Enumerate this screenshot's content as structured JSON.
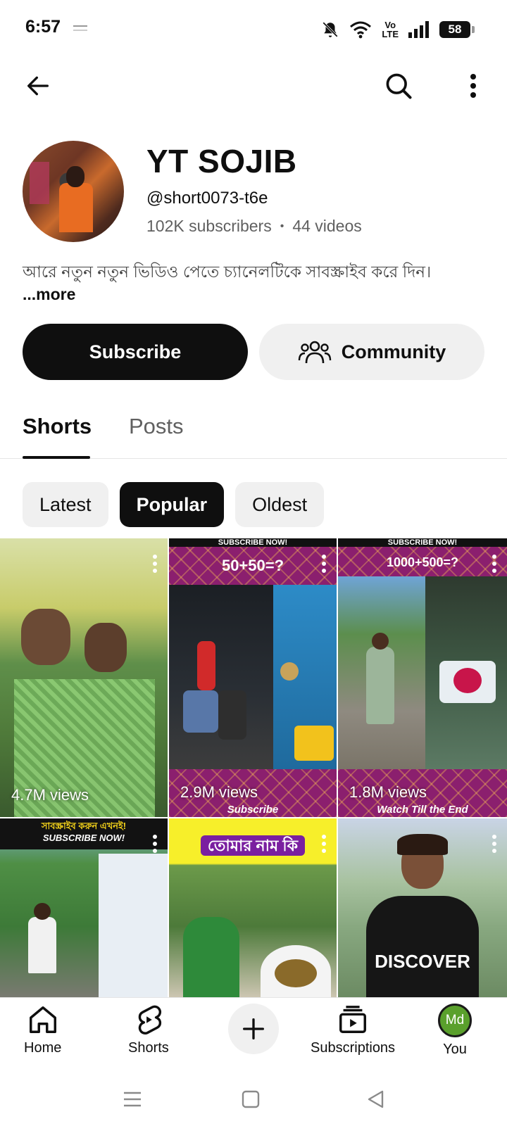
{
  "status_bar": {
    "time": "6:57",
    "network_label": "Vo\nLTE",
    "battery": "58"
  },
  "top_bar": {
    "icons": [
      "back-arrow-icon",
      "search-icon",
      "more-vert-icon"
    ]
  },
  "channel": {
    "name": "YT SOJIB",
    "handle": "@short0073-t6e",
    "subscribers": "102K subscribers",
    "separator": "•",
    "videos": "44 videos",
    "description": "আরে নতুন নতুন ভিডিও পেতে চ্যানেলটিকে সাবস্ক্রাইব করে দিন।",
    "more_label": "...more"
  },
  "actions": {
    "subscribe_label": "Subscribe",
    "community_label": "Community"
  },
  "tabs": [
    {
      "label": "Shorts",
      "active": true
    },
    {
      "label": "Posts",
      "active": false
    }
  ],
  "chips": [
    {
      "label": "Latest",
      "active": false
    },
    {
      "label": "Popular",
      "active": true
    },
    {
      "label": "Oldest",
      "active": false
    }
  ],
  "shorts": [
    {
      "views": "4.7M views",
      "overlay": ""
    },
    {
      "views": "2.9M views",
      "overlay": "50+50=?",
      "banner_top": "SUBSCRIBE NOW!",
      "banner_bottom": "Subscribe"
    },
    {
      "views": "1.8M views",
      "overlay": "1000+500=?",
      "banner_top": "SUBSCRIBE NOW!",
      "banner_bottom": "Watch Till the End"
    },
    {
      "views": "",
      "banner_top": "সাবস্ক্রাইব করুন এখনই!",
      "banner_sub": "SUBSCRIBE NOW!"
    },
    {
      "views": "",
      "overlay": "তোমার নাম কি"
    },
    {
      "views": "",
      "overlay": "DISCOVER"
    }
  ],
  "bottom_nav": {
    "home": "Home",
    "shorts": "Shorts",
    "subscriptions": "Subscriptions",
    "you": "You",
    "you_initials": "Md"
  },
  "colors": {
    "primary_text": "#0f0f0f",
    "secondary_text": "#606060",
    "chip_bg": "#f0f0f0",
    "accent_purple": "#8b1f6e",
    "avatar_green": "#5aa02c"
  }
}
